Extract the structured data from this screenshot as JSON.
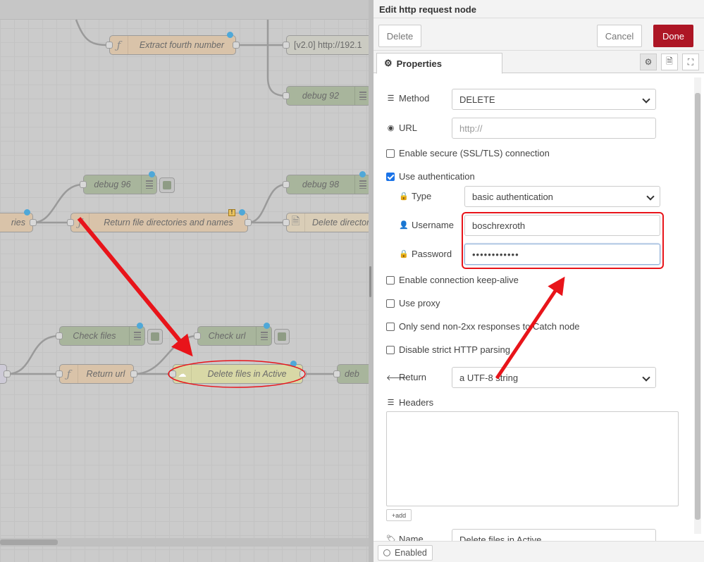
{
  "canvas": {
    "nodes": {
      "extract_fourth_number": "Extract fourth number",
      "http_v2": "[v2.0] http://192.1",
      "debug_92": "debug 92",
      "debug_96": "debug 96",
      "debug_98": "debug 98",
      "ries_partial": "ries",
      "return_file_dirs": "Return file directories and names",
      "delete_directory": "Delete director",
      "check_files": "Check files",
      "check_url": "Check url",
      "return_url": "Return url",
      "delete_files_active": "Delete files in Active",
      "debug_partial": "deb"
    }
  },
  "tray": {
    "title": "Edit http request node",
    "delete_label": "Delete",
    "cancel_label": "Cancel",
    "done_label": "Done",
    "tab_properties": "Properties",
    "method_label": "Method",
    "method_value": "DELETE",
    "url_label": "URL",
    "url_placeholder": "http://",
    "tls_label": "Enable secure (SSL/TLS) connection",
    "auth_label": "Use authentication",
    "type_label": "Type",
    "type_value": "basic authentication",
    "username_label": "Username",
    "username_value": "boschrexroth",
    "password_label": "Password",
    "password_value": "••••••••••••",
    "keepalive_label": "Enable connection keep-alive",
    "proxy_label": "Use proxy",
    "non2xx_label": "Only send non-2xx responses to Catch node",
    "strict_label": "Disable strict HTTP parsing",
    "return_label": "Return",
    "return_value": "a UTF-8 string",
    "headers_label": "Headers",
    "add_label": "add",
    "name_label": "Name",
    "name_value": "Delete files in Active",
    "enabled_label": "Enabled"
  },
  "colors": {
    "done_button": "#ad1625",
    "annotation_red": "#e8141a",
    "port_dot": "#4fa8d8",
    "checkbox_on": "#1a73e8"
  }
}
